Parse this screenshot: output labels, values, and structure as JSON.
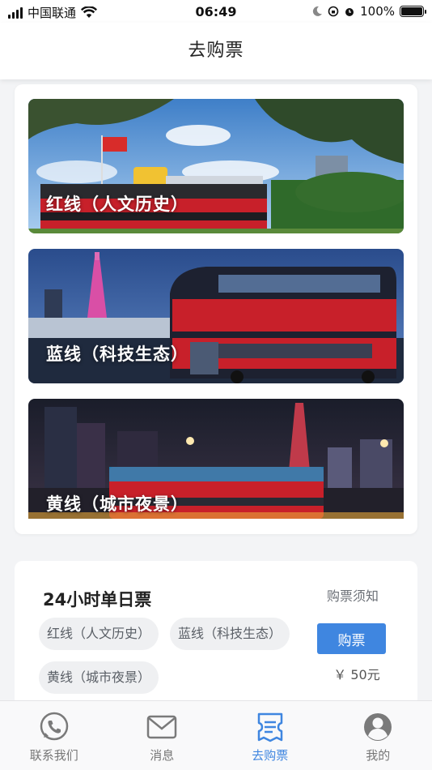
{
  "status_bar": {
    "carrier": "中国联通",
    "time": "06:49",
    "battery": "100%"
  },
  "header": {
    "title": "去购票"
  },
  "routes": [
    {
      "title": "红线（人文历史）"
    },
    {
      "title": "蓝线（科技生态）"
    },
    {
      "title": "黄线（城市夜景）"
    }
  ],
  "ticket": {
    "title": "24小时单日票",
    "notice": "购票须知",
    "chips": [
      "红线（人文历史）",
      "蓝线（科技生态）",
      "黄线（城市夜景）"
    ],
    "buy_label": "购票",
    "price": "￥ 50元"
  },
  "tabs": [
    {
      "label": "联系我们",
      "icon": "phone-icon",
      "active": false
    },
    {
      "label": "消息",
      "icon": "mail-icon",
      "active": false
    },
    {
      "label": "去购票",
      "icon": "ticket-icon",
      "active": true
    },
    {
      "label": "我的",
      "icon": "user-icon",
      "active": false
    }
  ],
  "colors": {
    "accent": "#3f86e0",
    "bus_red": "#c8202a",
    "background": "#f3f4f6"
  }
}
